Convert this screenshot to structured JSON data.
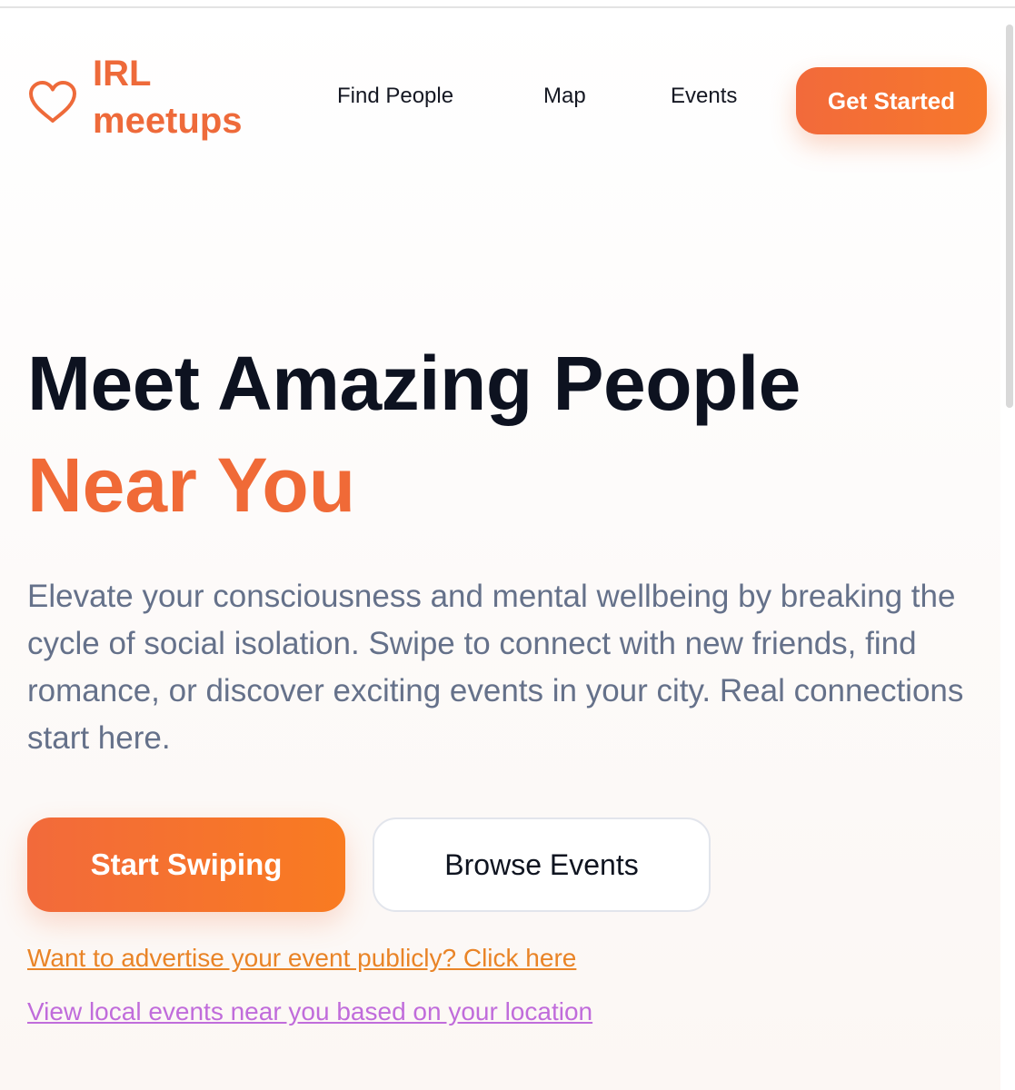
{
  "brand": {
    "icon": "heart-icon",
    "line1": "IRL",
    "line2": "meetups",
    "color": "#ee6a3a"
  },
  "nav": {
    "find_people": "Find People",
    "map": "Map",
    "events": "Events",
    "get_started": "Get Started"
  },
  "hero": {
    "title": "Meet Amazing People",
    "title_accent": "Near You",
    "description": "Elevate your consciousness and mental wellbeing by breaking the cycle of social isolation. Swipe to connect with new friends, find romance, or discover exciting events in your city. Real connections start here.",
    "primary_button": "Start Swiping",
    "secondary_button": "Browse Events",
    "advertise_link": "Want to advertise your event publicly? Click here",
    "local_events_link": "View local events near you based on your location"
  },
  "colors": {
    "accent": "#f06a37",
    "heading": "#0d1220",
    "body_text": "#65718a",
    "advertise_link": "#e98427",
    "local_link": "#c06cdb"
  }
}
